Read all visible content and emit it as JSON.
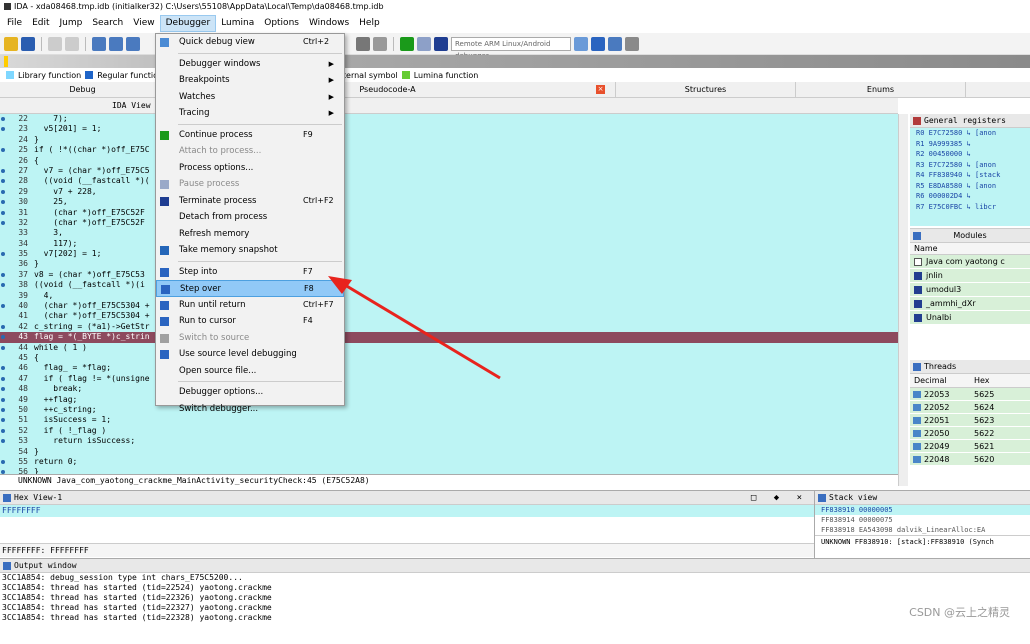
{
  "title": "IDA - xda08468.tmp.idb (initialker32) C:\\Users\\55108\\AppData\\Local\\Temp\\da08468.tmp.idb",
  "menu": [
    "File",
    "Edit",
    "Jump",
    "Search",
    "View",
    "Debugger",
    "Lumina",
    "Options",
    "Windows",
    "Help"
  ],
  "toolbar": {
    "debugger_select": "Remote ARM Linux/Android debugger"
  },
  "legend": {
    "library": "Library function",
    "regular": "Regular function",
    "external": "External symbol",
    "lumina": "Lumina function"
  },
  "tabs": [
    "Debug",
    "IDA View",
    "Pseudocode-A",
    "Structures",
    "Enums"
  ],
  "code": {
    "lines": [
      {
        "n": "22",
        "t": "    7);"
      },
      {
        "n": "23",
        "t": "  v5[201] = 1;"
      },
      {
        "n": "24",
        "t": "}"
      },
      {
        "n": "25",
        "t": "if ( !*((char *)off_E75C"
      },
      {
        "n": "26",
        "t": "{"
      },
      {
        "n": "27",
        "t": "  v7 = (char *)off_E75C5"
      },
      {
        "n": "28",
        "t": "  ((void (__fastcall *)(                          nk_E75C64F4)("
      },
      {
        "n": "29",
        "t": "    v7 + 228,"
      },
      {
        "n": "30",
        "t": "    25,"
      },
      {
        "n": "31",
        "t": "    (char *)off_E75C52F"
      },
      {
        "n": "32",
        "t": "    (char *)off_E75C52F"
      },
      {
        "n": "33",
        "t": "    3,"
      },
      {
        "n": "34",
        "t": "    117);"
      },
      {
        "n": "35",
        "t": "  v7[202] = 1;"
      },
      {
        "n": "36",
        "t": "}"
      },
      {
        "n": "37",
        "t": "v8 = (char *)off_E75C53"
      },
      {
        "n": "38",
        "t": "((void (__fastcall *)(i"
      },
      {
        "n": "39",
        "t": "  4,"
      },
      {
        "n": "40",
        "t": "  (char *)off_E75C5304 +"
      },
      {
        "n": "41",
        "t": "  (char *)off_E75C5304 +"
      },
      {
        "n": "42",
        "t": "c_string = (*a1)->GetStr"
      },
      {
        "n": "43",
        "t": "flag = *(_BYTE *)c_strin"
      },
      {
        "n": "44",
        "t": "while ( 1 )"
      },
      {
        "n": "45",
        "t": "{"
      },
      {
        "n": "46",
        "t": "  flag_ = *flag;"
      },
      {
        "n": "47",
        "t": "  if ( flag != *(unsigne"
      },
      {
        "n": "48",
        "t": "    break;"
      },
      {
        "n": "49",
        "t": "  ++flag;"
      },
      {
        "n": "50",
        "t": "  ++c_string;"
      },
      {
        "n": "51",
        "t": "  isSuccess = 1;"
      },
      {
        "n": "52",
        "t": "  if ( !_flag )"
      },
      {
        "n": "53",
        "t": "    return isSuccess;"
      },
      {
        "n": "54",
        "t": "}"
      },
      {
        "n": "55",
        "t": "return 0;"
      },
      {
        "n": "56",
        "t": "}"
      }
    ],
    "status": "UNKNOWN Java_com_yaotong_crackme_MainActivity_securityCheck:45 (E75C52A8)"
  },
  "registers": {
    "title": "General registers",
    "rows": [
      "R0 E7C72580 ↳ [anon",
      "R1 9A999385 ↳",
      "R2 00450000 ↳",
      "R3 E7C72580 ↳ [anon",
      "R4 FF838940 ↳ [stack",
      "R5 E8DA8580 ↳ [anon",
      "R6 000002D4 ↳",
      "R7 E75C0FBC ↳ libcr"
    ]
  },
  "modules": {
    "title": "Modules",
    "header": "Name",
    "rows": [
      "Java com yaotong c",
      "jnlin",
      "umodul3",
      "_ammhi_dXr",
      "Unalbi"
    ]
  },
  "threads": {
    "title": "Threads",
    "col_dec": "Decimal",
    "col_hex": "Hex",
    "rows": [
      [
        "22053",
        "5625"
      ],
      [
        "22052",
        "5624"
      ],
      [
        "22051",
        "5623"
      ],
      [
        "22050",
        "5622"
      ],
      [
        "22049",
        "5621"
      ],
      [
        "22048",
        "5620"
      ]
    ]
  },
  "hexview": {
    "title": "Hex View-1",
    "rows": [
      "FFFFFFFF",
      "",
      ""
    ],
    "footer": "FFFFFFFF: FFFFFFFF"
  },
  "stack": {
    "title": "Stack view",
    "rows": [
      "FF838910  00000005",
      "FF838914  00000075",
      "FF838918  EA543098  dalvik_LinearAlloc:EA"
    ],
    "footer": "UNKNOWN FF838910: [stack]:FF838910 (Synch"
  },
  "output": {
    "title": "Output window",
    "rows": [
      "3CC1A854: debug_session type int chars_E75C5200...",
      "3CC1A854: thread has started (tid=22524) yaotong.crackme",
      "3CC1A854: thread has started (tid=22326) yaotong.crackme",
      "3CC1A854: thread has started (tid=22327) yaotong.crackme",
      "3CC1A854: thread has started (tid=22328) yaotong.crackme"
    ]
  },
  "watermark": "CSDN @云上之精灵",
  "debugger_menu": [
    {
      "label": "Quick debug view",
      "shortcut": "Ctrl+2",
      "icon": "quick-view-icon",
      "color": "#4b8bd4"
    },
    {
      "sep": true
    },
    {
      "label": "Debugger windows",
      "submenu": true
    },
    {
      "label": "Breakpoints",
      "submenu": true
    },
    {
      "label": "Watches",
      "submenu": true
    },
    {
      "label": "Tracing",
      "submenu": true
    },
    {
      "sep": true
    },
    {
      "label": "Continue process",
      "shortcut": "F9",
      "icon": "play-icon",
      "color": "#1a9a1a"
    },
    {
      "label": "Attach to process...",
      "disabled": true
    },
    {
      "label": "Process options..."
    },
    {
      "label": "Pause process",
      "disabled": true,
      "icon": "pause-icon",
      "color": "#9aa9c8"
    },
    {
      "label": "Terminate process",
      "shortcut": "Ctrl+F2",
      "icon": "stop-icon",
      "color": "#1f3d91"
    },
    {
      "label": "Detach from process"
    },
    {
      "label": "Refresh memory"
    },
    {
      "label": "Take memory snapshot",
      "icon": "snapshot-icon",
      "color": "#2466b8"
    },
    {
      "sep": true
    },
    {
      "label": "Step into",
      "shortcut": "F7",
      "icon": "step-into-icon",
      "color": "#2a64c0"
    },
    {
      "label": "Step over",
      "shortcut": "F8",
      "icon": "step-over-icon",
      "color": "#2a64c0",
      "hover": true
    },
    {
      "label": "Run until return",
      "shortcut": "Ctrl+F7",
      "icon": "run-until-return-icon",
      "color": "#2a64c0"
    },
    {
      "label": "Run to cursor",
      "shortcut": "F4",
      "icon": "run-to-cursor-icon",
      "color": "#2a64c0"
    },
    {
      "label": "Switch to source",
      "disabled": true,
      "icon": "switch-source-icon",
      "color": "#a0a0a0"
    },
    {
      "label": "Use source level debugging",
      "icon": "source-debug-icon",
      "color": "#2a64c0"
    },
    {
      "label": "Open source file..."
    },
    {
      "sep": true
    },
    {
      "label": "Debugger options..."
    },
    {
      "label": "Switch debugger..."
    }
  ],
  "colors": {
    "code_bg": "#bdf4f4",
    "current_line": "#8d4a5e",
    "menu_hover": "#91c9f7",
    "arrow": "#e8231d",
    "library_fn": "#7fd7ff",
    "regular_fn": "#1e64c8",
    "external_sym": "#ff70ff",
    "lumina_fn": "#66cc33"
  }
}
